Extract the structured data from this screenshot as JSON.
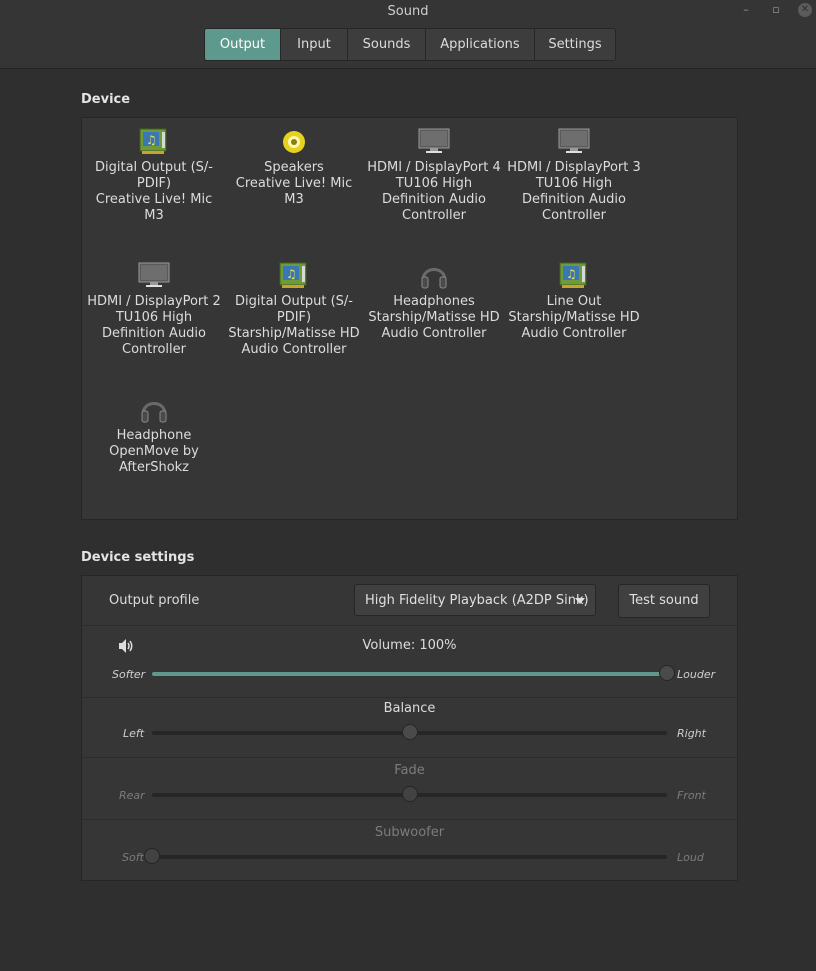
{
  "window": {
    "title": "Sound",
    "minimize": "–",
    "maximize": "▫",
    "close": "✕"
  },
  "tabs": [
    {
      "label": "Output",
      "active": true
    },
    {
      "label": "Input",
      "active": false
    },
    {
      "label": "Sounds",
      "active": false
    },
    {
      "label": "Applications",
      "active": false
    },
    {
      "label": "Settings",
      "active": false
    }
  ],
  "device_section": {
    "title": "Device"
  },
  "devices": [
    {
      "icon": "sound-card-icon",
      "name": "Digital Output (S/-PDIF)",
      "desc": "Creative Live! Mic M3"
    },
    {
      "icon": "speaker-icon",
      "name": "Speakers",
      "desc": "Creative Live! Mic M3"
    },
    {
      "icon": "monitor-icon",
      "name": "HDMI / DisplayPort 4",
      "desc": "TU106 High Definition Audio Controller"
    },
    {
      "icon": "monitor-icon",
      "name": "HDMI / DisplayPort 3",
      "desc": "TU106 High Definition Audio Controller"
    },
    {
      "icon": "monitor-icon",
      "name": "HDMI / DisplayPort 2",
      "desc": "TU106 High Definition Audio Controller"
    },
    {
      "icon": "sound-card-icon",
      "name": "Digital Output (S/-PDIF)",
      "desc": "Starship/Matisse HD Audio Controller"
    },
    {
      "icon": "headphones-icon",
      "name": "Headphones",
      "desc": "Starship/Matisse HD Audio Controller"
    },
    {
      "icon": "sound-card-icon",
      "name": "Line Out",
      "desc": "Starship/Matisse HD Audio Controller"
    },
    {
      "icon": "headphones-icon",
      "name": "Headphone",
      "desc": "OpenMove by AfterShokz"
    }
  ],
  "settings_section": {
    "title": "Device settings",
    "output_profile_label": "Output profile",
    "output_profile_value": "High Fidelity Playback (A2DP Sink)",
    "test_sound_label": "Test sound"
  },
  "sliders": {
    "volume": {
      "title": "Volume: 100%",
      "left": "Softer",
      "right": "Louder",
      "value": 1.0,
      "enabled": true
    },
    "balance": {
      "title": "Balance",
      "left": "Left",
      "right": "Right",
      "value": 0.5,
      "enabled": true
    },
    "fade": {
      "title": "Fade",
      "left": "Rear",
      "right": "Front",
      "value": 0.5,
      "enabled": false
    },
    "subwoofer": {
      "title": "Subwoofer",
      "left": "Soft",
      "right": "Loud",
      "value": 0.0,
      "enabled": false
    }
  },
  "colors": {
    "accent": "#5d9a8d",
    "background": "#2f2f2f",
    "panel": "#363636"
  }
}
